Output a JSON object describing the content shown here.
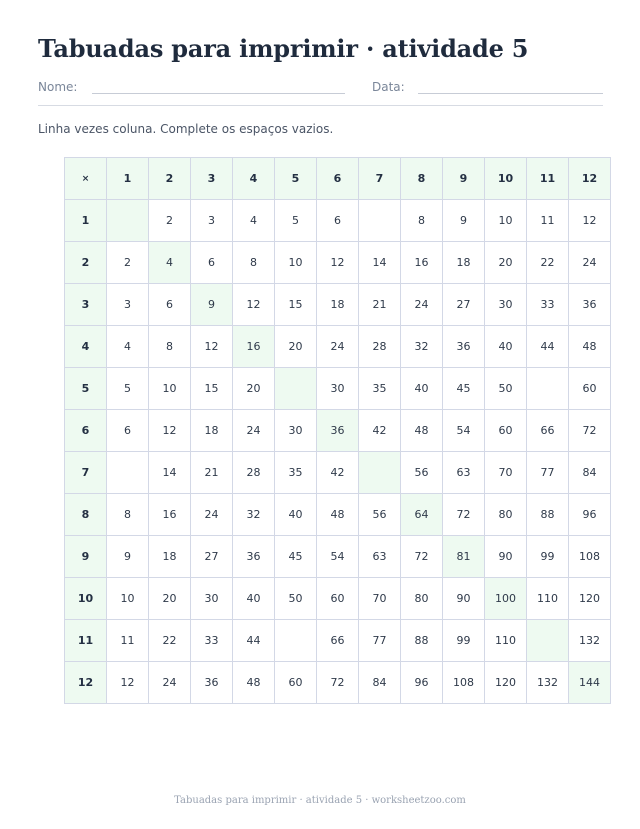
{
  "title": "Tabuadas para imprimir · atividade 5",
  "fields": {
    "name_label": "Nome:",
    "date_label": "Data:"
  },
  "instructions": "Linha vezes coluna. Complete os espaços vazios.",
  "table": {
    "corner": "×",
    "headers": [
      "1",
      "2",
      "3",
      "4",
      "5",
      "6",
      "7",
      "8",
      "9",
      "10",
      "11",
      "12"
    ],
    "rows": [
      {
        "label": "1",
        "cells": [
          "",
          "2",
          "3",
          "4",
          "5",
          "6",
          "",
          "8",
          "9",
          "10",
          "11",
          "12"
        ]
      },
      {
        "label": "2",
        "cells": [
          "2",
          "4",
          "6",
          "8",
          "10",
          "12",
          "14",
          "16",
          "18",
          "20",
          "22",
          "24"
        ]
      },
      {
        "label": "3",
        "cells": [
          "3",
          "6",
          "9",
          "12",
          "15",
          "18",
          "21",
          "24",
          "27",
          "30",
          "33",
          "36"
        ]
      },
      {
        "label": "4",
        "cells": [
          "4",
          "8",
          "12",
          "16",
          "20",
          "24",
          "28",
          "32",
          "36",
          "40",
          "44",
          "48"
        ]
      },
      {
        "label": "5",
        "cells": [
          "5",
          "10",
          "15",
          "20",
          "",
          "30",
          "35",
          "40",
          "45",
          "50",
          "",
          "60"
        ]
      },
      {
        "label": "6",
        "cells": [
          "6",
          "12",
          "18",
          "24",
          "30",
          "36",
          "42",
          "48",
          "54",
          "60",
          "66",
          "72"
        ]
      },
      {
        "label": "7",
        "cells": [
          "",
          "14",
          "21",
          "28",
          "35",
          "42",
          "",
          "56",
          "63",
          "70",
          "77",
          "84"
        ]
      },
      {
        "label": "8",
        "cells": [
          "8",
          "16",
          "24",
          "32",
          "40",
          "48",
          "56",
          "64",
          "72",
          "80",
          "88",
          "96"
        ]
      },
      {
        "label": "9",
        "cells": [
          "9",
          "18",
          "27",
          "36",
          "45",
          "54",
          "63",
          "72",
          "81",
          "90",
          "99",
          "108"
        ]
      },
      {
        "label": "10",
        "cells": [
          "10",
          "20",
          "30",
          "40",
          "50",
          "60",
          "70",
          "80",
          "90",
          "100",
          "110",
          "120"
        ]
      },
      {
        "label": "11",
        "cells": [
          "11",
          "22",
          "33",
          "44",
          "",
          "66",
          "77",
          "88",
          "99",
          "110",
          "",
          "132"
        ]
      },
      {
        "label": "12",
        "cells": [
          "12",
          "24",
          "36",
          "48",
          "60",
          "72",
          "84",
          "96",
          "108",
          "120",
          "132",
          "144"
        ]
      }
    ]
  },
  "footer": "Tabuadas para imprimir · atividade 5 · worksheetzoo.com"
}
